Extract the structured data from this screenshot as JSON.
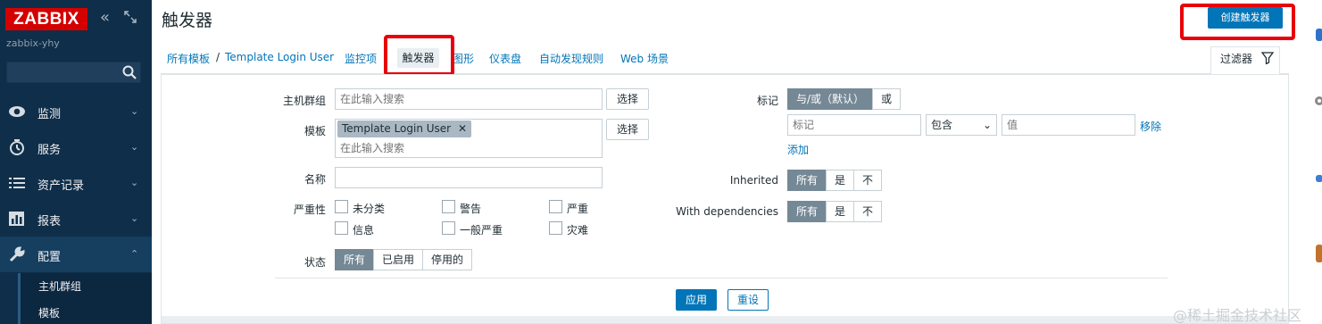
{
  "app": {
    "logo": "ZABBIX",
    "server_name": "zabbix-yhy"
  },
  "sidebar": {
    "search_placeholder": "",
    "items": [
      {
        "label": "监测",
        "icon": "eye-icon"
      },
      {
        "label": "服务",
        "icon": "clock-icon"
      },
      {
        "label": "资产记录",
        "icon": "list-icon"
      },
      {
        "label": "报表",
        "icon": "bar-chart-icon"
      },
      {
        "label": "配置",
        "icon": "wrench-icon"
      }
    ],
    "sub_items": [
      {
        "label": "主机群组"
      },
      {
        "label": "模板"
      }
    ]
  },
  "header": {
    "title": "触发器",
    "create_button": "创建触发器"
  },
  "breadcrumb": {
    "all_templates": "所有模板",
    "separator": "/",
    "template": "Template Login User",
    "tabs": [
      {
        "label": "监控项"
      },
      {
        "label": "触发器"
      },
      {
        "label": "图形"
      },
      {
        "label": "仪表盘"
      },
      {
        "label": "自动发现规则"
      },
      {
        "label": "Web 场景"
      }
    ]
  },
  "filter": {
    "tab_label": "过滤器",
    "host_groups": {
      "label": "主机群组",
      "placeholder": "在此输入搜索",
      "select": "选择"
    },
    "templates": {
      "label": "模板",
      "chip": "Template Login User",
      "placeholder": "在此输入搜索",
      "select": "选择"
    },
    "name": {
      "label": "名称",
      "value": ""
    },
    "severity": {
      "label": "严重性",
      "options": [
        "未分类",
        "警告",
        "严重",
        "信息",
        "一般严重",
        "灾难"
      ]
    },
    "state": {
      "label": "状态",
      "options": [
        "所有",
        "已启用",
        "停用的"
      ],
      "selected": "所有"
    },
    "tags": {
      "label": "标记",
      "mode_options": [
        "与/或（默认）",
        "或"
      ],
      "mode_selected": "与/或（默认）",
      "tag_placeholder": "标记",
      "operator": "包含",
      "value_placeholder": "值",
      "remove": "移除",
      "add": "添加"
    },
    "inherited": {
      "label": "Inherited",
      "options": [
        "所有",
        "是",
        "不"
      ],
      "selected": "所有"
    },
    "with_dependencies": {
      "label": "With dependencies",
      "options": [
        "所有",
        "是",
        "不"
      ],
      "selected": "所有"
    },
    "apply": "应用",
    "reset": "重设"
  },
  "watermark": "@稀土掘金技术社区",
  "colors": {
    "accent": "#0275b8",
    "sidebar": "#0f2e49",
    "logo": "#d40000",
    "highlight": "#e8000a"
  }
}
